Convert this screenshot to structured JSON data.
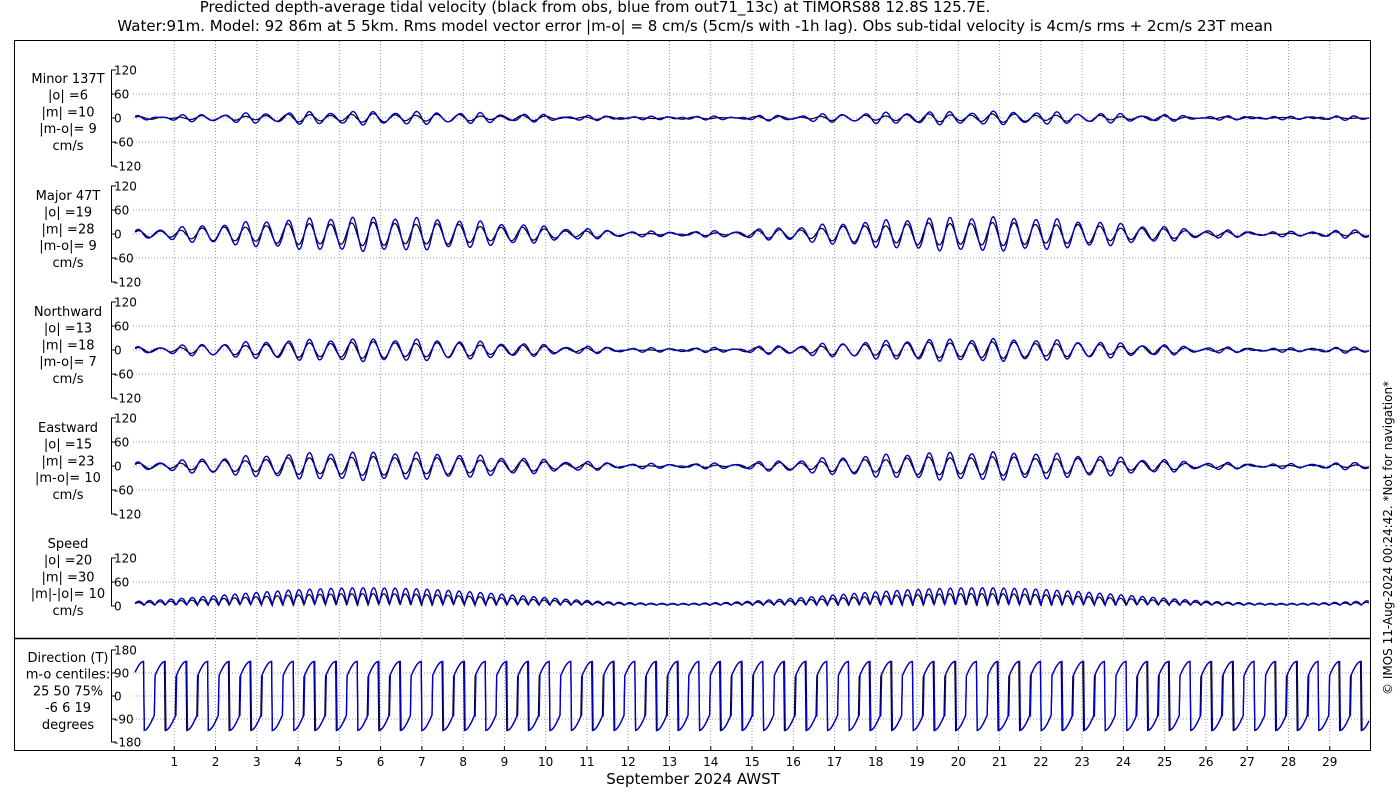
{
  "title": {
    "line1": "Predicted depth-average tidal velocity (black from obs, blue from out71_13c) at TIMORS88 12.8S 125.7E.",
    "line2": "Water:91m. Model: 92 86m at 5 5km. Rms model vector error |m-o| = 8 cm/s (5cm/s with -1h lag). Obs sub-tidal velocity is 4cm/s rms + 2cm/s 23T mean"
  },
  "side_note": "© IMOS 11-Aug-2024 00:24:42. *Not for navigation*",
  "colors": {
    "obs": "#000000",
    "model": "#0000cc",
    "grid": "#9a9a9a"
  },
  "chart_data": {
    "type": "line",
    "xlabel": "September 2024 AWST",
    "x_ticks": [
      "1",
      "2",
      "3",
      "4",
      "5",
      "6",
      "7",
      "8",
      "9",
      "10",
      "11",
      "12",
      "13",
      "14",
      "15",
      "16",
      "17",
      "18",
      "19",
      "20",
      "21",
      "22",
      "23",
      "24",
      "25",
      "26",
      "27",
      "28",
      "29"
    ],
    "xlim_days": [
      0,
      30
    ],
    "grid": true,
    "series_names": [
      "obs",
      "model"
    ],
    "panels": [
      {
        "id": "minor",
        "label_lines": [
          "Minor 137T",
          "|o| =6",
          "|m| =10",
          "|m-o|= 9",
          "cm/s"
        ],
        "ylim": [
          -120,
          120
        ],
        "yticks": [
          "120",
          "60",
          "0",
          "-60",
          "-120"
        ],
        "obs_amplitude": 6,
        "model_amplitude": 10
      },
      {
        "id": "major",
        "label_lines": [
          "Major 47T",
          "|o| =19",
          "|m| =28",
          "|m-o|= 9",
          "cm/s"
        ],
        "ylim": [
          -120,
          120
        ],
        "yticks": [
          "120",
          "60",
          "0",
          "-60",
          "-120"
        ],
        "obs_amplitude": 19,
        "model_amplitude": 28
      },
      {
        "id": "north",
        "label_lines": [
          "Northward",
          "|o| =13",
          "|m| =18",
          "|m-o|= 7",
          "cm/s"
        ],
        "ylim": [
          -120,
          120
        ],
        "yticks": [
          "120",
          "60",
          "0",
          "-60",
          "-120"
        ],
        "obs_amplitude": 13,
        "model_amplitude": 18
      },
      {
        "id": "east",
        "label_lines": [
          "Eastward",
          "|o| =15",
          "|m| =23",
          "|m-o|= 10",
          "cm/s"
        ],
        "ylim": [
          -120,
          120
        ],
        "yticks": [
          "120",
          "60",
          "0",
          "-60",
          "-120"
        ],
        "obs_amplitude": 15,
        "model_amplitude": 23
      },
      {
        "id": "speed",
        "label_lines": [
          "Speed",
          "|o| =20",
          "|m| =30",
          "|m|-|o|= 10",
          "cm/s"
        ],
        "ylim": [
          0,
          120
        ],
        "yticks": [
          "120",
          "60",
          "0"
        ],
        "obs_amplitude": 20,
        "model_amplitude": 30
      },
      {
        "id": "direction",
        "label_lines": [
          "Direction (T)",
          "m-o centiles:",
          "25  50  75%",
          "-6   6  19",
          "degrees"
        ],
        "ylim": [
          -180,
          180
        ],
        "yticks": [
          "180",
          "90",
          "0",
          "-90",
          "-180"
        ]
      }
    ]
  }
}
